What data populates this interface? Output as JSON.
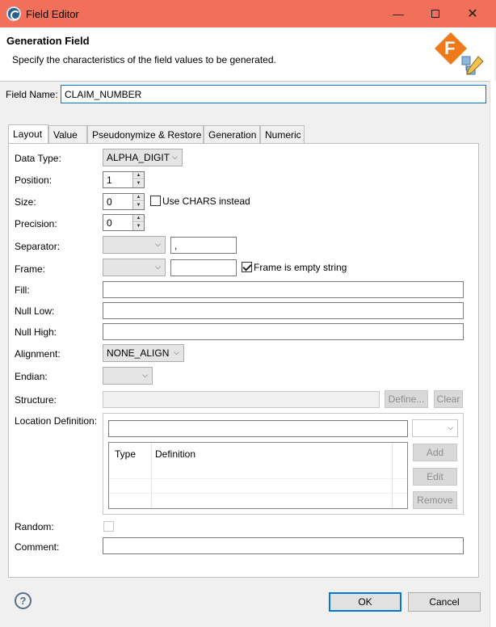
{
  "window": {
    "title": "Field Editor",
    "controls": [
      "minimize-icon",
      "maximize-icon",
      "close-icon"
    ]
  },
  "header": {
    "title": "Generation Field",
    "description": "Specify the characteristics of the field values to be generated."
  },
  "field_name": {
    "label": "Field Name:",
    "value": "CLAIM_NUMBER"
  },
  "tabs": [
    {
      "label": "Layout",
      "active": true
    },
    {
      "label": "Value",
      "active": false
    },
    {
      "label": "Pseudonymize & Restore",
      "active": false
    },
    {
      "label": "Generation",
      "active": false
    },
    {
      "label": "Numeric",
      "active": false
    }
  ],
  "layout": {
    "data_type": {
      "label": "Data Type:",
      "value": "ALPHA_DIGIT"
    },
    "position": {
      "label": "Position:",
      "value": "1"
    },
    "size": {
      "label": "Size:",
      "value": "0",
      "checkbox_label": "Use CHARS instead",
      "checked": false
    },
    "precision": {
      "label": "Precision:",
      "value": "0"
    },
    "separator": {
      "label": "Separator:",
      "combo_value": "",
      "text_value": ","
    },
    "frame": {
      "label": "Frame:",
      "combo_value": "",
      "text_value": "",
      "checkbox_label": "Frame is empty string",
      "checked": true
    },
    "fill": {
      "label": "Fill:",
      "value": ""
    },
    "null_low": {
      "label": "Null Low:",
      "value": ""
    },
    "null_high": {
      "label": "Null High:",
      "value": ""
    },
    "alignment": {
      "label": "Alignment:",
      "value": "NONE_ALIGN"
    },
    "endian": {
      "label": "Endian:",
      "value": ""
    },
    "structure": {
      "label": "Structure:",
      "value": "",
      "define_label": "Define...",
      "clear_label": "Clear"
    },
    "location_definition": {
      "label": "Location Definition:",
      "value": "",
      "columns": [
        "Type",
        "Definition"
      ],
      "add_label": "Add",
      "edit_label": "Edit",
      "remove_label": "Remove"
    },
    "random": {
      "label": "Random:",
      "checked": false
    },
    "comment": {
      "label": "Comment:",
      "value": ""
    }
  },
  "footer": {
    "help_glyph": "?",
    "ok_label": "OK",
    "cancel_label": "Cancel"
  },
  "colors": {
    "titlebar": "#f0705a",
    "focus": "#0078d7",
    "logo": "#f07a1a"
  }
}
